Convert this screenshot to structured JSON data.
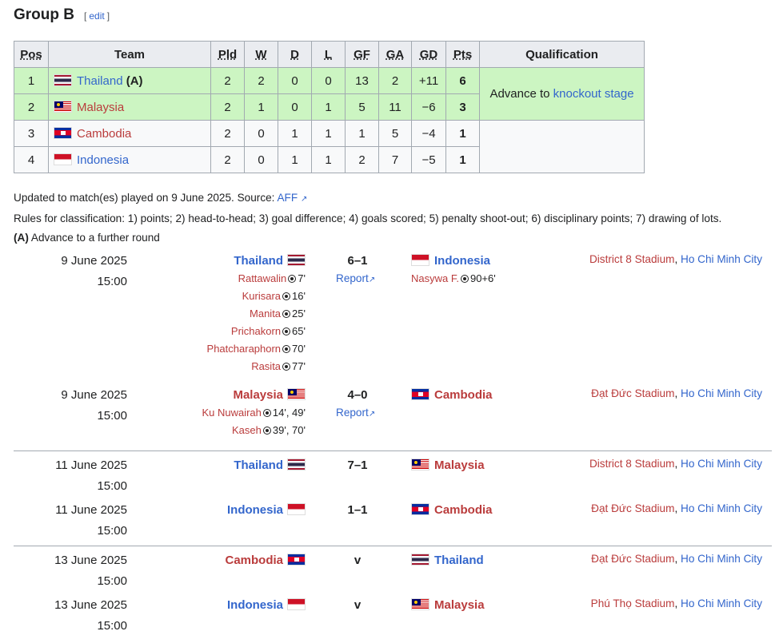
{
  "heading": {
    "title": "Group B",
    "edit_open": "[",
    "edit_label": "edit",
    "edit_close": "]"
  },
  "table": {
    "headers": [
      "Pos",
      "Team",
      "Pld",
      "W",
      "D",
      "L",
      "GF",
      "GA",
      "GD",
      "Pts",
      "Qualification"
    ],
    "rows": [
      {
        "pos": "1",
        "team": "Thailand",
        "note": "(A)",
        "pld": "2",
        "w": "2",
        "d": "0",
        "l": "0",
        "gf": "13",
        "ga": "2",
        "gd": "+11",
        "pts": "6",
        "flag": "flag-th"
      },
      {
        "pos": "2",
        "team": "Malaysia",
        "note": "",
        "pld": "2",
        "w": "1",
        "d": "0",
        "l": "1",
        "gf": "5",
        "ga": "11",
        "gd": "−6",
        "pts": "3",
        "flag": "flag-my"
      },
      {
        "pos": "3",
        "team": "Cambodia",
        "note": "",
        "pld": "2",
        "w": "0",
        "d": "1",
        "l": "1",
        "gf": "1",
        "ga": "5",
        "gd": "−4",
        "pts": "1",
        "flag": "flag-kh"
      },
      {
        "pos": "4",
        "team": "Indonesia",
        "note": "",
        "pld": "2",
        "w": "0",
        "d": "1",
        "l": "1",
        "gf": "2",
        "ga": "7",
        "gd": "−5",
        "pts": "1",
        "flag": "flag-id"
      }
    ],
    "qualification_prefix": "Advance to ",
    "qualification_link": "knockout stage"
  },
  "notes": {
    "updated": "Updated to match(es) played on 9 June 2025. Source: ",
    "source": "AFF",
    "rules": "Rules for classification: 1) points; 2) head-to-head; 3) goal difference; 4) goals scored; 5) penalty shoot-out; 6) disciplinary points; 7) drawing of lots.",
    "legend_key": "(A)",
    "legend_text": " Advance to a further round"
  },
  "matches": [
    {
      "date": "9 June 2025",
      "time": "15:00",
      "home": "Thailand",
      "home_flag": "flag-th",
      "score": "6–1",
      "away": "Indonesia",
      "away_flag": "flag-id",
      "stadium": "District 8 Stadium",
      "city": "Ho Chi Minh City",
      "report": "Report",
      "home_scorers": [
        {
          "name": "Rattawalin",
          "min": "7'"
        },
        {
          "name": "Kurisara",
          "min": "16'"
        },
        {
          "name": "Manita",
          "min": "25'"
        },
        {
          "name": "Prichakorn",
          "min": "65'"
        },
        {
          "name": "Phatcharaphorn",
          "min": "70'"
        },
        {
          "name": "Rasita",
          "min": "77'"
        }
      ],
      "away_scorers": [
        {
          "name": "Nasywa F.",
          "min": "90+6'"
        }
      ]
    },
    {
      "date": "9 June 2025",
      "time": "15:00",
      "home": "Malaysia",
      "home_flag": "flag-my",
      "score": "4–0",
      "away": "Cambodia",
      "away_flag": "flag-kh",
      "stadium": "Đạt Đức Stadium",
      "city": "Ho Chi Minh City",
      "report": "Report",
      "home_scorers": [
        {
          "name": "Ku Nuwairah",
          "min": "14', 49'"
        },
        {
          "name": "Kaseh",
          "min": "39', 70'"
        }
      ],
      "away_scorers": []
    },
    {
      "date": "11 June 2025",
      "time": "15:00",
      "home": "Thailand",
      "home_flag": "flag-th",
      "score": "7–1",
      "away": "Malaysia",
      "away_flag": "flag-my",
      "stadium": "District 8 Stadium",
      "city": "Ho Chi Minh City"
    },
    {
      "date": "11 June 2025",
      "time": "15:00",
      "home": "Indonesia",
      "home_flag": "flag-id",
      "score": "1–1",
      "away": "Cambodia",
      "away_flag": "flag-kh",
      "stadium": "Đạt Đức Stadium",
      "city": "Ho Chi Minh City"
    },
    {
      "date": "13 June 2025",
      "time": "15:00",
      "home": "Cambodia",
      "home_flag": "flag-kh",
      "score": "v",
      "away": "Thailand",
      "away_flag": "flag-th",
      "stadium": "Đạt Đức Stadium",
      "city": "Ho Chi Minh City"
    },
    {
      "date": "13 June 2025",
      "time": "15:00",
      "home": "Indonesia",
      "home_flag": "flag-id",
      "score": "v",
      "away": "Malaysia",
      "away_flag": "flag-my",
      "stadium": "Phú Thọ Stadium",
      "city": "Ho Chi Minh City"
    }
  ]
}
